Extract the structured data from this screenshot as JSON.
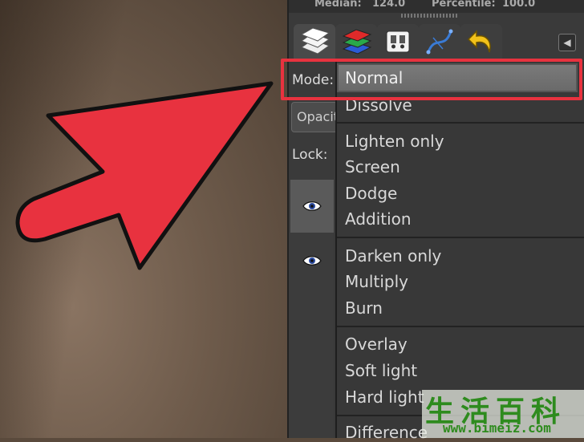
{
  "histogram": {
    "median_label": "Median:",
    "median_value": "124.0",
    "percentile_label": "Percentile:",
    "percentile_value": "100.0"
  },
  "tabs": [
    {
      "name": "layers",
      "icon": "layers-icon"
    },
    {
      "name": "channels",
      "icon": "channels-icon"
    },
    {
      "name": "paths",
      "icon": "paths-icon"
    },
    {
      "name": "colormap",
      "icon": "colormap-icon"
    },
    {
      "name": "undo-history",
      "icon": "undo-icon"
    }
  ],
  "layers_panel": {
    "mode_label": "Mode:",
    "opacity_label": "Opacity",
    "lock_label": "Lock:"
  },
  "mode_dropdown": {
    "selected": "Normal",
    "groups": [
      [
        "Dissolve"
      ],
      [
        "Lighten only",
        "Screen",
        "Dodge",
        "Addition"
      ],
      [
        "Darken only",
        "Multiply",
        "Burn"
      ],
      [
        "Overlay",
        "Soft light",
        "Hard light"
      ],
      [
        "Difference"
      ]
    ]
  },
  "watermark": {
    "chars": "生活百科",
    "url": "www.bimeiz.com"
  },
  "colors": {
    "annotation_red": "#e8323f",
    "panel_bg": "#3a3a3a",
    "watermark_green": "#2e8b1e"
  }
}
